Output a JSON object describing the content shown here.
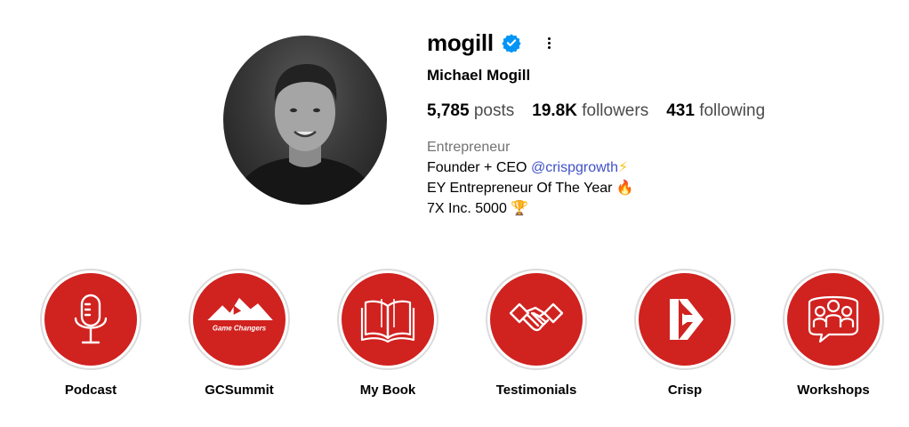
{
  "profile": {
    "username": "mogill",
    "full_name": "Michael Mogill",
    "verified": true,
    "avatar": "profile-photo",
    "stats": {
      "posts_count": "5,785",
      "posts_label": "posts",
      "followers_count": "19.8K",
      "followers_label": "followers",
      "following_count": "431",
      "following_label": "following"
    },
    "bio": {
      "category": "Entrepreneur",
      "line1_prefix": "Founder + CEO ",
      "line1_mention": "@crispgrowth",
      "line1_emoji": "⚡",
      "line2_text": "EY Entrepreneur Of The Year ",
      "line2_emoji": "🔥",
      "line3_text": "7X Inc. 5000 ",
      "line3_emoji": "🏆"
    }
  },
  "highlights": [
    {
      "label": "Podcast",
      "icon": "microphone-icon"
    },
    {
      "label": "GCSummit",
      "icon": "game-changers-logo",
      "logo_text": "Game Changers"
    },
    {
      "label": "My Book",
      "icon": "book-icon"
    },
    {
      "label": "Testimonials",
      "icon": "handshake-icon"
    },
    {
      "label": "Crisp",
      "icon": "crisp-logo-icon"
    },
    {
      "label": "Workshops",
      "icon": "group-chat-icon"
    }
  ],
  "colors": {
    "highlight_bg": "#d0221f",
    "verified_blue": "#0095f6",
    "mention": "#3f51c7",
    "secondary_text": "#737373"
  }
}
